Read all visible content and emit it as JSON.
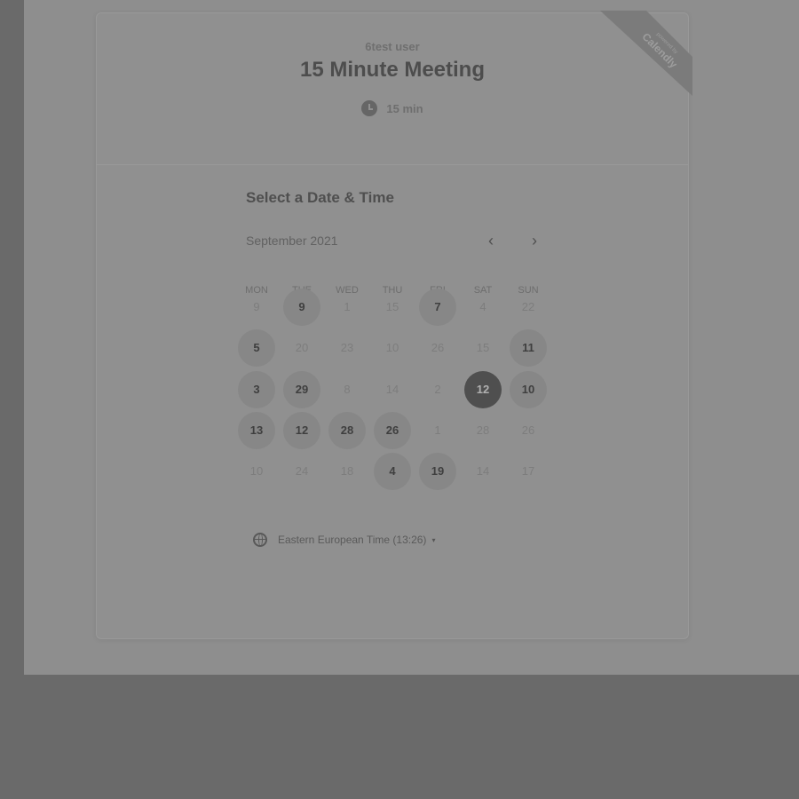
{
  "event": {
    "user_name": "6test user",
    "title": "15 Minute Meeting",
    "duration": "15 min"
  },
  "ribbon": {
    "small_text": "powered by",
    "brand_text": "Calendly"
  },
  "scheduler": {
    "section_title": "Select a Date & Time",
    "month_label": "September 2021",
    "prev_icon": "‹",
    "next_icon": "›",
    "weekdays": [
      "MON",
      "TUE",
      "WED",
      "THU",
      "FRI",
      "SAT",
      "SUN"
    ],
    "weeks": [
      [
        {
          "label": "9",
          "available": false,
          "selected": false
        },
        {
          "label": "9",
          "available": true,
          "selected": false
        },
        {
          "label": "1",
          "available": false,
          "selected": false
        },
        {
          "label": "15",
          "available": false,
          "selected": false
        },
        {
          "label": "7",
          "available": true,
          "selected": false
        },
        {
          "label": "4",
          "available": false,
          "selected": false
        },
        {
          "label": "22",
          "available": false,
          "selected": false
        }
      ],
      [
        {
          "label": "5",
          "available": true,
          "selected": false
        },
        {
          "label": "20",
          "available": false,
          "selected": false
        },
        {
          "label": "23",
          "available": false,
          "selected": false
        },
        {
          "label": "10",
          "available": false,
          "selected": false
        },
        {
          "label": "26",
          "available": false,
          "selected": false
        },
        {
          "label": "15",
          "available": false,
          "selected": false
        },
        {
          "label": "11",
          "available": true,
          "selected": false
        }
      ],
      [
        {
          "label": "3",
          "available": true,
          "selected": false
        },
        {
          "label": "29",
          "available": true,
          "selected": false
        },
        {
          "label": "8",
          "available": false,
          "selected": false
        },
        {
          "label": "14",
          "available": false,
          "selected": false
        },
        {
          "label": "2",
          "available": false,
          "selected": false
        },
        {
          "label": "12",
          "available": true,
          "selected": true
        },
        {
          "label": "10",
          "available": true,
          "selected": false
        }
      ],
      [
        {
          "label": "13",
          "available": true,
          "selected": false
        },
        {
          "label": "12",
          "available": true,
          "selected": false
        },
        {
          "label": "28",
          "available": true,
          "selected": false
        },
        {
          "label": "26",
          "available": true,
          "selected": false
        },
        {
          "label": "1",
          "available": false,
          "selected": false
        },
        {
          "label": "28",
          "available": false,
          "selected": false
        },
        {
          "label": "26",
          "available": false,
          "selected": false
        }
      ],
      [
        {
          "label": "10",
          "available": false,
          "selected": false
        },
        {
          "label": "24",
          "available": false,
          "selected": false
        },
        {
          "label": "18",
          "available": false,
          "selected": false
        },
        {
          "label": "4",
          "available": true,
          "selected": false
        },
        {
          "label": "19",
          "available": true,
          "selected": false
        },
        {
          "label": "14",
          "available": false,
          "selected": false
        },
        {
          "label": "17",
          "available": false,
          "selected": false
        }
      ]
    ],
    "timezone_label": "Eastern European Time (13:26)",
    "timezone_caret": "▾"
  },
  "colors": {
    "backdrop": "#6a6a6a",
    "page": "#8e8e8e",
    "selected_day": "#4f4f4f",
    "available_day": "#878787"
  },
  "icons": {
    "duration": "clock-icon",
    "timezone": "globe-icon"
  }
}
